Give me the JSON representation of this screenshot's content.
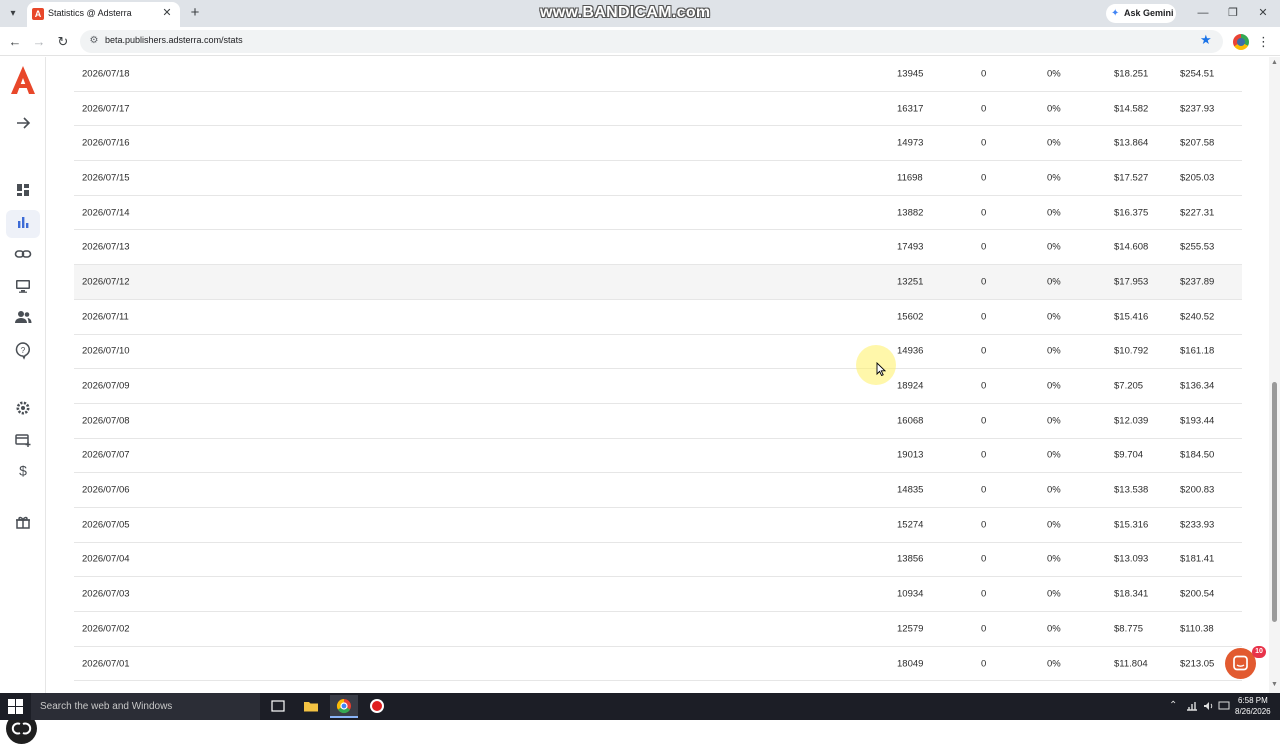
{
  "browser": {
    "tab_title": "Statistics @ Adsterra",
    "tab_favicon_letter": "A",
    "new_tab_symbol": "+",
    "watermark": "www.BANDICAM.com",
    "gemini_label": "Ask Gemini",
    "url": "beta.publishers.adsterra.com/stats"
  },
  "stats": {
    "rows": [
      {
        "date": "2026/07/18",
        "impressions": "13945",
        "clicks": "0",
        "ctr": "0%",
        "cpm": "$18.251",
        "revenue": "$254.51"
      },
      {
        "date": "2026/07/17",
        "impressions": "16317",
        "clicks": "0",
        "ctr": "0%",
        "cpm": "$14.582",
        "revenue": "$237.93"
      },
      {
        "date": "2026/07/16",
        "impressions": "14973",
        "clicks": "0",
        "ctr": "0%",
        "cpm": "$13.864",
        "revenue": "$207.58"
      },
      {
        "date": "2026/07/15",
        "impressions": "11698",
        "clicks": "0",
        "ctr": "0%",
        "cpm": "$17.527",
        "revenue": "$205.03"
      },
      {
        "date": "2026/07/14",
        "impressions": "13882",
        "clicks": "0",
        "ctr": "0%",
        "cpm": "$16.375",
        "revenue": "$227.31"
      },
      {
        "date": "2026/07/13",
        "impressions": "17493",
        "clicks": "0",
        "ctr": "0%",
        "cpm": "$14.608",
        "revenue": "$255.53"
      },
      {
        "date": "2026/07/12",
        "impressions": "13251",
        "clicks": "0",
        "ctr": "0%",
        "cpm": "$17.953",
        "revenue": "$237.89"
      },
      {
        "date": "2026/07/11",
        "impressions": "15602",
        "clicks": "0",
        "ctr": "0%",
        "cpm": "$15.416",
        "revenue": "$240.52"
      },
      {
        "date": "2026/07/10",
        "impressions": "14936",
        "clicks": "0",
        "ctr": "0%",
        "cpm": "$10.792",
        "revenue": "$161.18"
      },
      {
        "date": "2026/07/09",
        "impressions": "18924",
        "clicks": "0",
        "ctr": "0%",
        "cpm": "$7.205",
        "revenue": "$136.34"
      },
      {
        "date": "2026/07/08",
        "impressions": "16068",
        "clicks": "0",
        "ctr": "0%",
        "cpm": "$12.039",
        "revenue": "$193.44"
      },
      {
        "date": "2026/07/07",
        "impressions": "19013",
        "clicks": "0",
        "ctr": "0%",
        "cpm": "$9.704",
        "revenue": "$184.50"
      },
      {
        "date": "2026/07/06",
        "impressions": "14835",
        "clicks": "0",
        "ctr": "0%",
        "cpm": "$13.538",
        "revenue": "$200.83"
      },
      {
        "date": "2026/07/05",
        "impressions": "15274",
        "clicks": "0",
        "ctr": "0%",
        "cpm": "$15.316",
        "revenue": "$233.93"
      },
      {
        "date": "2026/07/04",
        "impressions": "13856",
        "clicks": "0",
        "ctr": "0%",
        "cpm": "$13.093",
        "revenue": "$181.41"
      },
      {
        "date": "2026/07/03",
        "impressions": "10934",
        "clicks": "0",
        "ctr": "0%",
        "cpm": "$18.341",
        "revenue": "$200.54"
      },
      {
        "date": "2026/07/02",
        "impressions": "12579",
        "clicks": "0",
        "ctr": "0%",
        "cpm": "$8.775",
        "revenue": "$110.38"
      },
      {
        "date": "2026/07/01",
        "impressions": "18049",
        "clicks": "0",
        "ctr": "0%",
        "cpm": "$11.804",
        "revenue": "$213.05"
      }
    ]
  },
  "chat": {
    "badge_count": "10"
  },
  "taskbar": {
    "search_placeholder": "Search the web and Windows",
    "time": "6:58 PM",
    "date": "8/26/2026"
  },
  "colors": {
    "brand": "#e8472a",
    "accent": "#3d6bd6",
    "chat": "#e25a30"
  },
  "icons": {
    "sidebar": [
      "expand-arrow-icon",
      "dashboard-icon",
      "statistics-icon",
      "link-icon",
      "monitor-icon",
      "referrals-icon",
      "help-icon",
      "settings-icon",
      "payment-card-icon",
      "dollar-icon",
      "gift-icon"
    ]
  }
}
